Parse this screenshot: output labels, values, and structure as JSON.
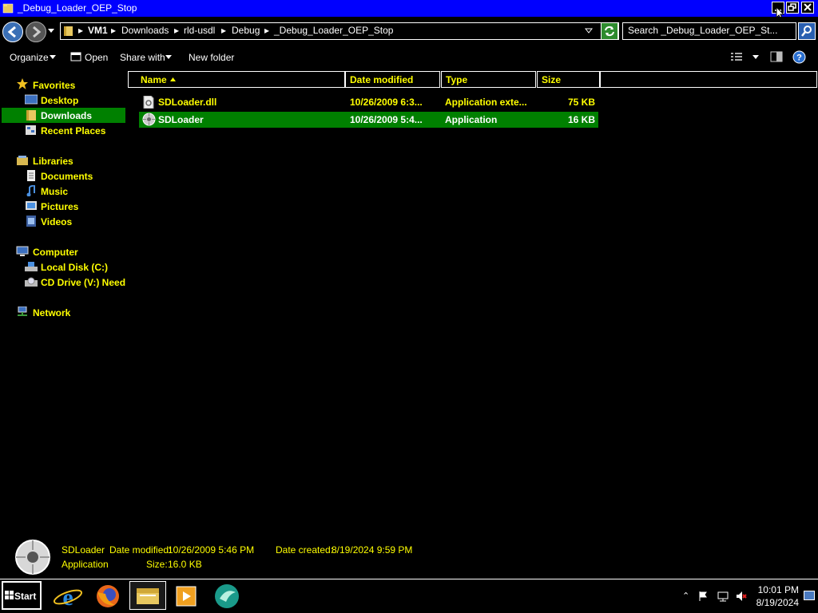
{
  "window": {
    "title": "_Debug_Loader_OEP_Stop"
  },
  "address": {
    "breadcrumbs": [
      "VM1",
      "Downloads",
      "rld-usdl",
      "Debug",
      "_Debug_Loader_OEP_Stop"
    ],
    "search_placeholder": "Search _Debug_Loader_OEP_St..."
  },
  "toolbar": {
    "organize": "Organize",
    "open": "Open",
    "share_with": "Share with",
    "new_folder": "New folder"
  },
  "nav": {
    "favorites": "Favorites",
    "desktop": "Desktop",
    "downloads": "Downloads",
    "recent_places": "Recent Places",
    "libraries": "Libraries",
    "documents": "Documents",
    "music": "Music",
    "pictures": "Pictures",
    "videos": "Videos",
    "computer": "Computer",
    "local_disk": "Local Disk (C:)",
    "cd_drive": "CD Drive (V:) Need",
    "network": "Network"
  },
  "columns": {
    "name": "Name",
    "date_modified": "Date modified",
    "type": "Type",
    "size": "Size"
  },
  "files": [
    {
      "name": "SDLoader.dll",
      "date": "10/26/2009 6:3...",
      "type": "Application exte...",
      "size": "75 KB"
    },
    {
      "name": "SDLoader",
      "date": "10/26/2009 5:4...",
      "type": "Application",
      "size": "16 KB"
    }
  ],
  "details": {
    "name": "SDLoader",
    "kind": "Application",
    "date_modified_label": "Date modified:",
    "date_modified": "10/26/2009 5:46 PM",
    "date_created_label": "Date created:",
    "date_created": "8/19/2024 9:59 PM",
    "size_label": "Size:",
    "size": "16.0 KB"
  },
  "taskbar": {
    "start": "Start",
    "time": "10:01 PM",
    "date": "8/19/2024"
  },
  "colors": {
    "title_bar": "#0000ff",
    "selection": "#008000",
    "text_accent": "#ffff00"
  }
}
